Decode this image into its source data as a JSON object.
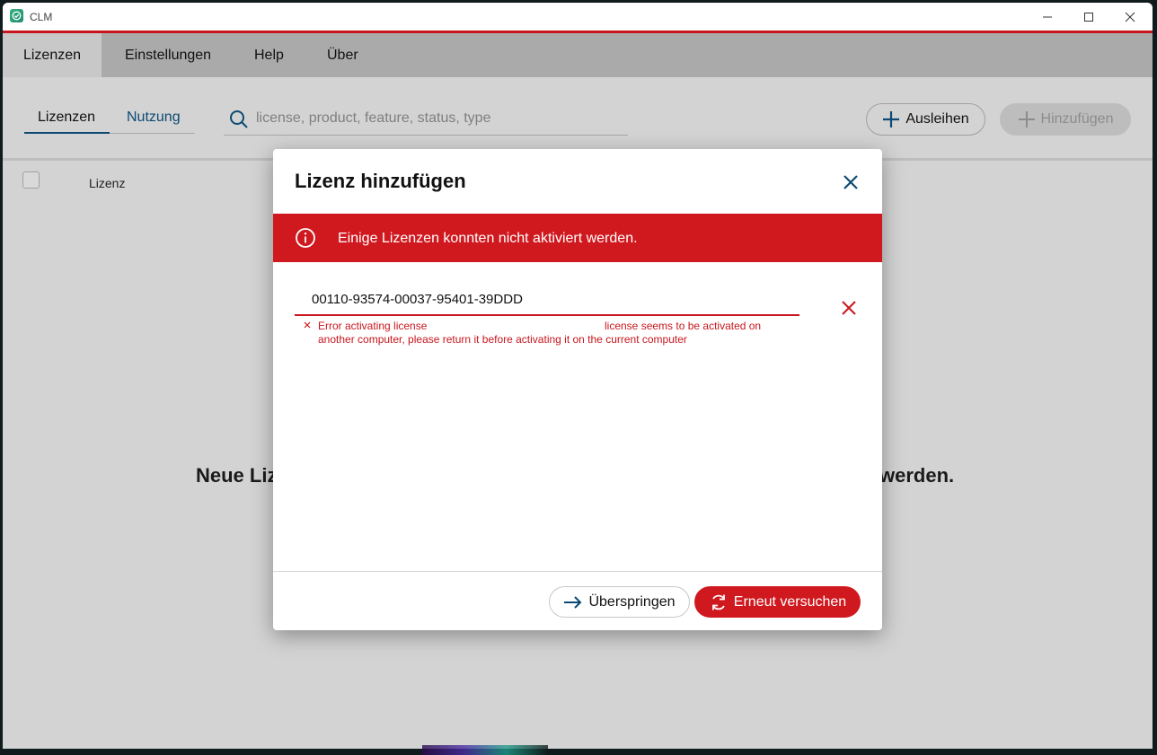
{
  "window": {
    "app_title": "CLM",
    "accent_color": "#c8161d"
  },
  "menu": {
    "items": [
      {
        "label": "Lizenzen",
        "active": true
      },
      {
        "label": "Einstellungen",
        "active": false
      },
      {
        "label": "Help",
        "active": false
      },
      {
        "label": "Über",
        "active": false
      }
    ]
  },
  "toolbar": {
    "subtabs": [
      {
        "label": "Lizenzen",
        "active": true
      },
      {
        "label": "Nutzung",
        "active": false
      }
    ],
    "search_placeholder": "license, product, feature, status, type",
    "borrow_label": "Ausleihen",
    "add_label": "Hinzufügen"
  },
  "table": {
    "columns": [
      "Lizenz"
    ]
  },
  "empty_state": {
    "left_text": "Neue Liz",
    "right_text": "werden."
  },
  "dialog": {
    "title": "Lizenz hinzufügen",
    "banner_text": "Einige Lizenzen konnten nicht aktiviert werden.",
    "banner_color": "#d0191f",
    "license_key": "00110-93574-00037-95401-39DDD",
    "error_line1_a": "Error activating license",
    "error_line1_b": "license seems to be activated on",
    "error_line2": "another computer, please return it before activating it on the current computer",
    "skip_label": "Überspringen",
    "retry_label": "Erneut versuchen"
  }
}
